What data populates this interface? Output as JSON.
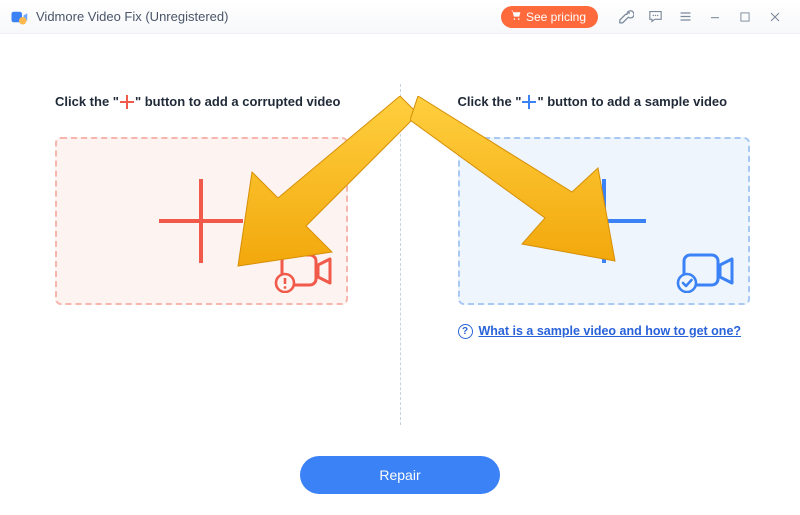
{
  "header": {
    "title": "Vidmore Video Fix (Unregistered)",
    "see_pricing": "See pricing"
  },
  "left": {
    "instruction_pre": "Click the \"",
    "instruction_post": "\" button to add a corrupted video"
  },
  "right": {
    "instruction_pre": "Click the \"",
    "instruction_post": "\" button to add a sample video",
    "help_text": "What is a sample video and how to get one?"
  },
  "footer": {
    "repair_label": "Repair"
  }
}
